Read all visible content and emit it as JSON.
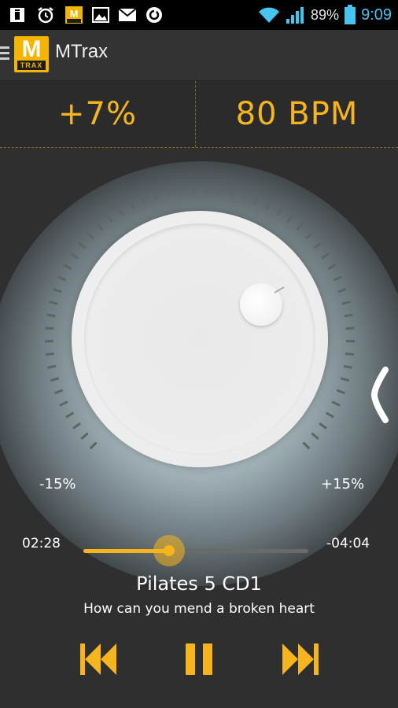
{
  "status_bar": {
    "battery": "89%",
    "time": "9:09",
    "icons": [
      "sim-icon",
      "alarm-icon",
      "mtrax-notification-icon",
      "gallery-icon",
      "email-icon",
      "sync-icon",
      "wifi-icon",
      "signal-icon",
      "battery-icon"
    ]
  },
  "app": {
    "title": "MTrax",
    "logo_letter": "M",
    "logo_sub": "TRAX"
  },
  "info": {
    "pitch": "+7%",
    "bpm": "80 BPM"
  },
  "dial": {
    "min_label": "-15%",
    "max_label": "+15%"
  },
  "player": {
    "elapsed": "02:28",
    "remaining": "-04:04",
    "progress": 0.38,
    "track_title": "Pilates 5 CD1",
    "track_subtitle": "How can you mend a broken heart"
  },
  "colors": {
    "accent": "#f6b51c",
    "background": "#2f2f2f",
    "status_time": "#46c6ee"
  }
}
